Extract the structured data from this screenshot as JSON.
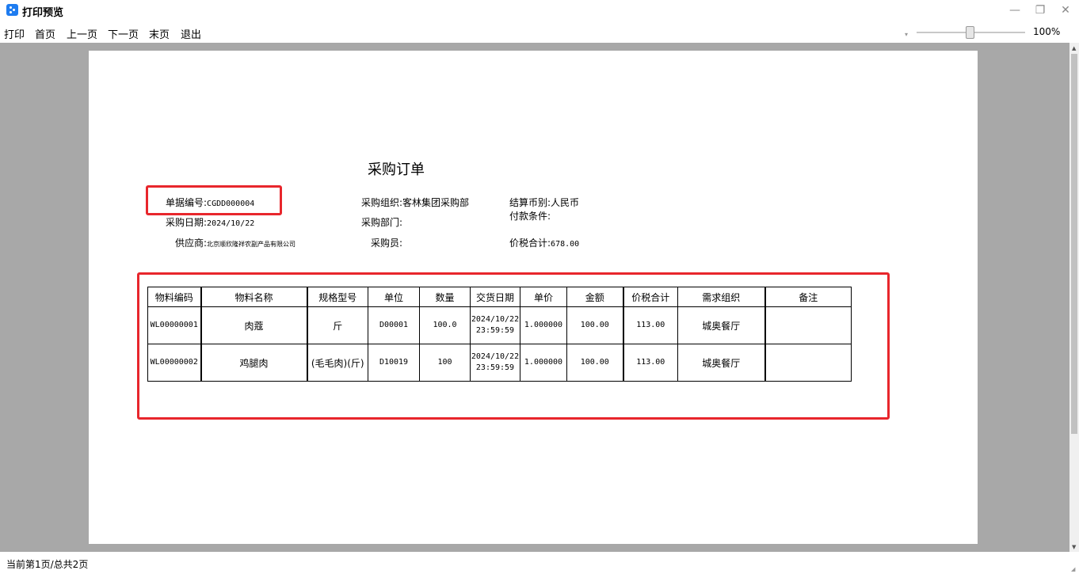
{
  "window": {
    "title": "打印预览",
    "min_glyph": "—",
    "max_glyph": "❐",
    "close_glyph": "✕"
  },
  "menu": {
    "print": "打印",
    "first": "首页",
    "prev": "上一页",
    "next": "下一页",
    "last": "末页",
    "exit": "退出"
  },
  "zoom": {
    "label": "100%",
    "value_percent": 100
  },
  "document": {
    "title": "采购订单",
    "fields": {
      "order_no": {
        "label": "单据编号:",
        "value": "CGDD000004"
      },
      "purchase_date": {
        "label": "采购日期:",
        "value": "2024/10/22"
      },
      "supplier": {
        "label": "供应商:",
        "value": "北京顺欣隆祥农副产品有限公司"
      },
      "purchase_org": {
        "label": "采购组织:",
        "value": "客林集团采购部"
      },
      "purchase_dept": {
        "label": "采购部门:",
        "value": ""
      },
      "purchaser": {
        "label": "采购员:",
        "value": ""
      },
      "currency": {
        "label": "结算币别:",
        "value": "人民币"
      },
      "payment_terms": {
        "label": "付款条件:",
        "value": ""
      },
      "total_with_tax": {
        "label": "价税合计:",
        "value": "678.00"
      }
    },
    "table": {
      "headers": [
        "物料编码",
        "物料名称",
        "规格型号",
        "单位",
        "数量",
        "交货日期",
        "单价",
        "金额",
        "价税合计",
        "需求组织",
        "备注"
      ],
      "rows": [
        {
          "code": "WL00000001",
          "name": "肉蔻",
          "spec": "斤",
          "unit": "D00001",
          "qty": "100.0",
          "date": "2024/10/22",
          "time": "23:59:59",
          "price": "1.000000",
          "amount": "100.00",
          "total": "113.00",
          "org": "城奥餐厅",
          "note": ""
        },
        {
          "code": "WL00000002",
          "name": "鸡腿肉",
          "spec": "(毛毛肉)(斤)",
          "unit": "D10019",
          "qty": "100",
          "date": "2024/10/22",
          "time": "23:59:59",
          "price": "1.000000",
          "amount": "100.00",
          "total": "113.00",
          "org": "城奥餐厅",
          "note": ""
        }
      ]
    }
  },
  "status": {
    "text": "当前第1页/总共2页"
  },
  "colors": {
    "highlight": "#e8262c",
    "viewport_bg": "#a8a8a8",
    "app_icon": "#1e7cf0"
  }
}
